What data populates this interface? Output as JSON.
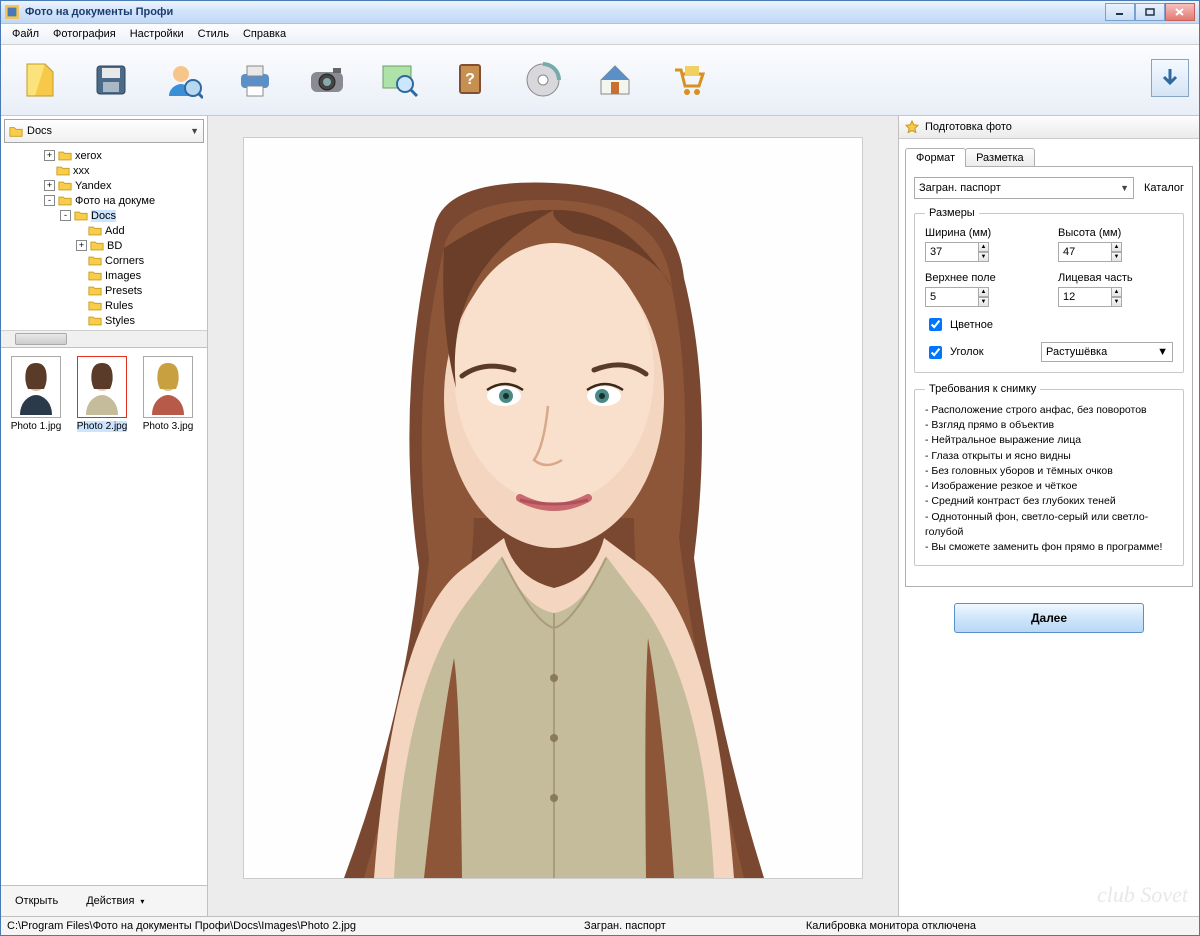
{
  "window": {
    "title": "Фото на документы Профи"
  },
  "menu": [
    "Файл",
    "Фотография",
    "Настройки",
    "Стиль",
    "Справка"
  ],
  "toolbar_names": [
    "new-button",
    "save-button",
    "person-button",
    "print-button",
    "camera-button",
    "zoom-button",
    "help-button",
    "cd-button",
    "home-button",
    "cart-button"
  ],
  "left": {
    "combo": "Docs",
    "tree": [
      {
        "indent": 40,
        "exp": "+",
        "label": "xerox"
      },
      {
        "indent": 40,
        "exp": "",
        "label": "xxx"
      },
      {
        "indent": 40,
        "exp": "+",
        "label": "Yandex"
      },
      {
        "indent": 40,
        "exp": "-",
        "label": "Фото на докуме"
      },
      {
        "indent": 56,
        "exp": "-",
        "label": "Docs",
        "sel": true
      },
      {
        "indent": 72,
        "exp": "",
        "label": "Add"
      },
      {
        "indent": 72,
        "exp": "+",
        "label": "BD"
      },
      {
        "indent": 72,
        "exp": "",
        "label": "Corners"
      },
      {
        "indent": 72,
        "exp": "",
        "label": "Images"
      },
      {
        "indent": 72,
        "exp": "",
        "label": "Presets"
      },
      {
        "indent": 72,
        "exp": "",
        "label": "Rules"
      },
      {
        "indent": 72,
        "exp": "",
        "label": "Styles"
      }
    ],
    "thumbs": [
      {
        "label": "Photo 1.jpg",
        "selected": false
      },
      {
        "label": "Photo 2.jpg",
        "selected": true
      },
      {
        "label": "Photo 3.jpg",
        "selected": false
      }
    ],
    "open": "Открыть",
    "actions": "Действия"
  },
  "right": {
    "header": "Подготовка фото",
    "tabs": [
      "Формат",
      "Разметка"
    ],
    "format_value": "Загран. паспорт",
    "catalog": "Каталог",
    "sizes_legend": "Размеры",
    "width_label": "Ширина (мм)",
    "width_value": "37",
    "height_label": "Высота (мм)",
    "height_value": "47",
    "top_label": "Верхнее поле",
    "top_value": "5",
    "face_label": "Лицевая часть",
    "face_value": "12",
    "color_label": "Цветное",
    "corner_label": "Уголок",
    "style_value": "Растушёвка",
    "req_legend": "Требования к снимку",
    "requirements": [
      "Расположение строго анфас, без поворотов",
      "Взгляд прямо в объектив",
      "Нейтральное выражение лица",
      "Глаза открыты и ясно видны",
      "Без головных уборов и тёмных очков",
      "Изображение резкое и чёткое",
      "Средний контраст без глубоких теней",
      "Однотонный фон, светло-серый или светло-голубой",
      "Вы сможете заменить фон прямо в программе!"
    ],
    "next": "Далее"
  },
  "status": {
    "path": "C:\\Program Files\\Фото на документы Профи\\Docs\\Images\\Photo 2.jpg",
    "format": "Загран. паспорт",
    "calib": "Калибровка монитора отключена"
  },
  "watermark": "club Sovet"
}
